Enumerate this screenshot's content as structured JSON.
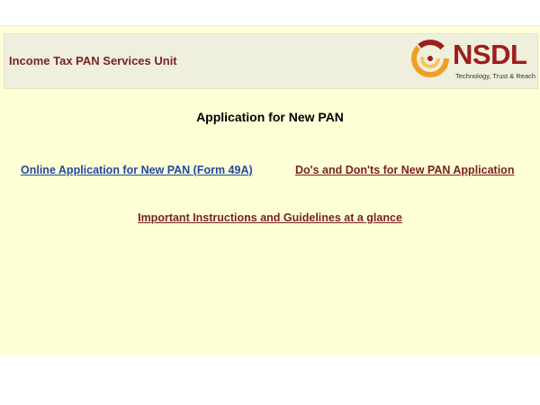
{
  "header": {
    "unit_title": "Income Tax PAN Services Unit",
    "logo_text": "NSDL",
    "logo_tagline": "Technology, Trust & Reach",
    "logo_icon": "nsdl-swirl-icon"
  },
  "main": {
    "title": "Application for New PAN",
    "links": {
      "online_application": "Online Application for New PAN (Form 49A)",
      "dos_and_donts": "Do's and Don'ts for New PAN Application",
      "guidelines": "Important Instructions and Guidelines at a glance"
    }
  },
  "colors": {
    "page_background": "#ffffd6",
    "header_background": "#efefdd",
    "maroon_text": "#7a1f1f",
    "link_blue": "#1f4aa0",
    "logo_orange": "#f0a020"
  }
}
